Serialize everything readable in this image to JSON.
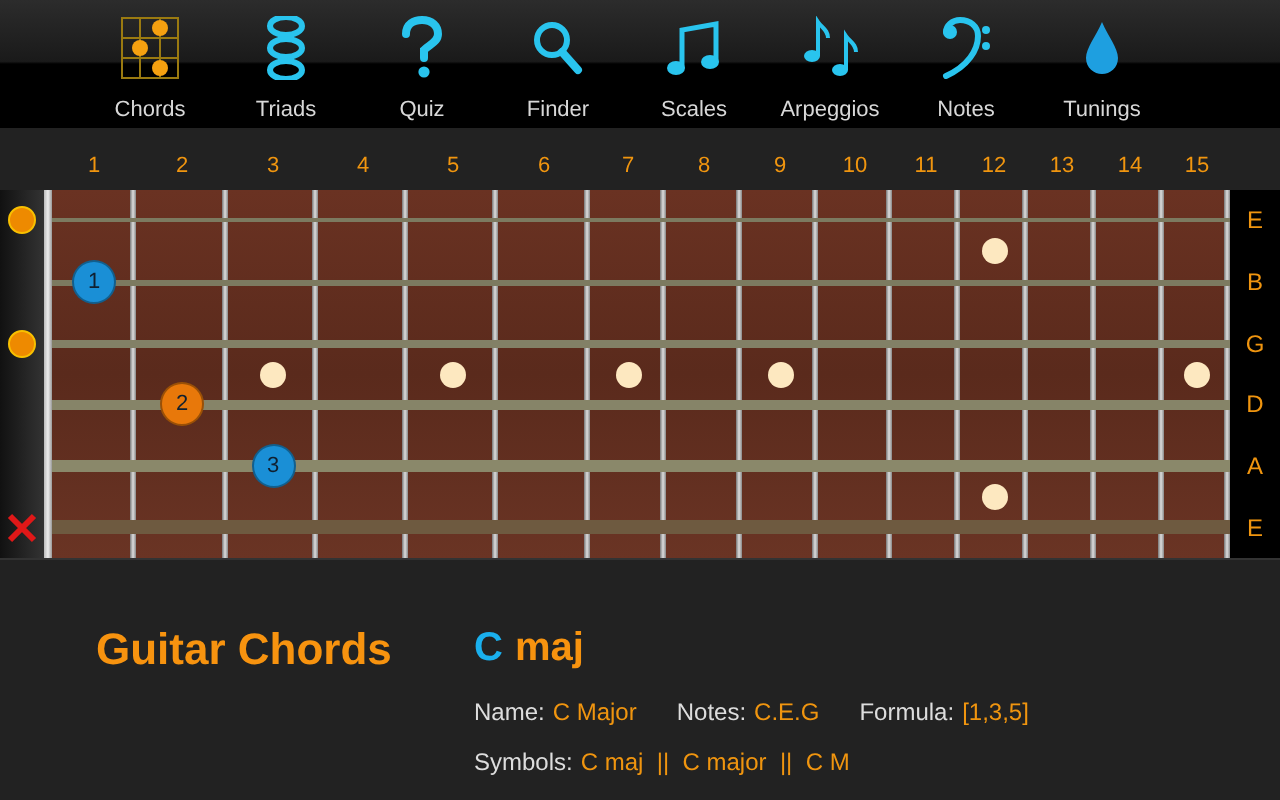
{
  "nav": [
    {
      "label": "Chords",
      "kind": "chords"
    },
    {
      "label": "Triads",
      "kind": "triads"
    },
    {
      "label": "Quiz",
      "kind": "quiz"
    },
    {
      "label": "Finder",
      "kind": "finder"
    },
    {
      "label": "Scales",
      "kind": "scales"
    },
    {
      "label": "Arpeggios",
      "kind": "arpeggios"
    },
    {
      "label": "Notes",
      "kind": "notes"
    },
    {
      "label": "Tunings",
      "kind": "tunings"
    }
  ],
  "fret_numbers": [
    "1",
    "2",
    "3",
    "4",
    "5",
    "6",
    "7",
    "8",
    "9",
    "10",
    "11",
    "12",
    "13",
    "14",
    "15"
  ],
  "strings": [
    {
      "label": "E",
      "kind": "open"
    },
    {
      "label": "B",
      "kind": "fretted",
      "frets": [
        {
          "kind": "finger",
          "finger": "1",
          "color": "#1a8fd6"
        }
      ]
    },
    {
      "label": "G",
      "kind": "open"
    },
    {
      "label": "D",
      "kind": "fretted",
      "frets": [
        {
          "kind": "empty"
        },
        {
          "kind": "finger",
          "finger": "2",
          "color": "#e8780a"
        }
      ]
    },
    {
      "label": "A",
      "kind": "fretted",
      "frets": [
        {
          "kind": "empty"
        },
        {
          "kind": "empty"
        },
        {
          "kind": "finger",
          "finger": "3",
          "color": "#1a8fd6"
        }
      ]
    },
    {
      "label": "E",
      "kind": "muted"
    }
  ],
  "title": "Guitar Chords",
  "chord": {
    "root": "C",
    "quality": "maj"
  },
  "details": [
    [
      {
        "label": "Name:",
        "value": "C Major"
      },
      {
        "label": "Notes:",
        "value": "C.E.G"
      },
      {
        "label": "Formula:",
        "value": "[1,3,5]"
      }
    ],
    [
      {
        "label": "Symbols:",
        "value": "C maj  ||  C major  ||  C M"
      }
    ]
  ]
}
